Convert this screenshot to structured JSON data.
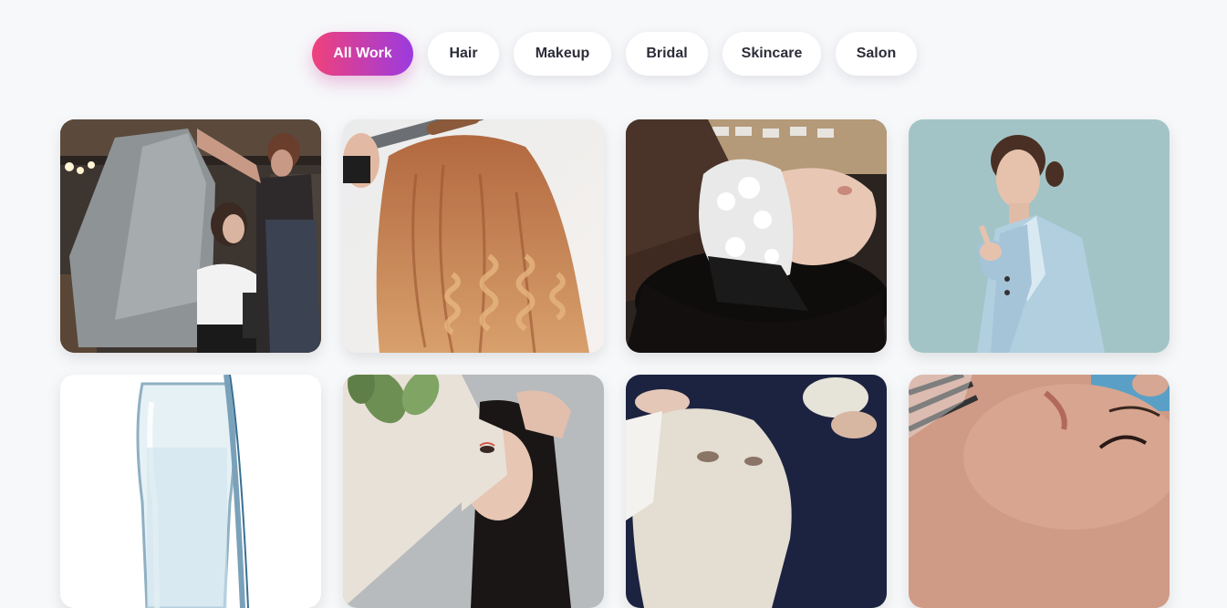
{
  "filters": [
    {
      "label": "All Work",
      "active": true
    },
    {
      "label": "Hair",
      "active": false
    },
    {
      "label": "Makeup",
      "active": false
    },
    {
      "label": "Bridal",
      "active": false
    },
    {
      "label": "Skincare",
      "active": false
    },
    {
      "label": "Salon",
      "active": false
    }
  ],
  "gallery": [
    {
      "id": "haircut-cape"
    },
    {
      "id": "curling-iron"
    },
    {
      "id": "hair-wash"
    },
    {
      "id": "blue-suit-portrait"
    },
    {
      "id": "glass-water"
    },
    {
      "id": "leaf-portrait"
    },
    {
      "id": "face-mask"
    },
    {
      "id": "facial-closeup"
    }
  ],
  "accent": {
    "start": "#f0417a",
    "end": "#9b3be0"
  }
}
